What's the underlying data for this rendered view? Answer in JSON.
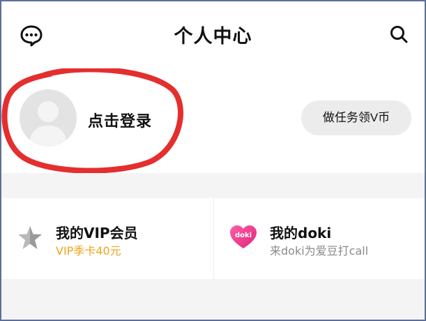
{
  "header": {
    "title": "个人中心",
    "left_icon": "message-icon",
    "right_icon": "search-icon"
  },
  "profile": {
    "login_text": "点击登录",
    "task_button": "做任务领V币",
    "annotation_color": "#e52e2e"
  },
  "cards": {
    "vip": {
      "title": "我的VIP会员",
      "subtitle": "VIP季卡40元",
      "icon": "star-icon",
      "subtitle_color": "#f0a51e"
    },
    "doki": {
      "title": "我的doki",
      "subtitle": "来doki为爱豆打call",
      "icon_label": "doki",
      "brand_color": "#f23a8a"
    }
  }
}
